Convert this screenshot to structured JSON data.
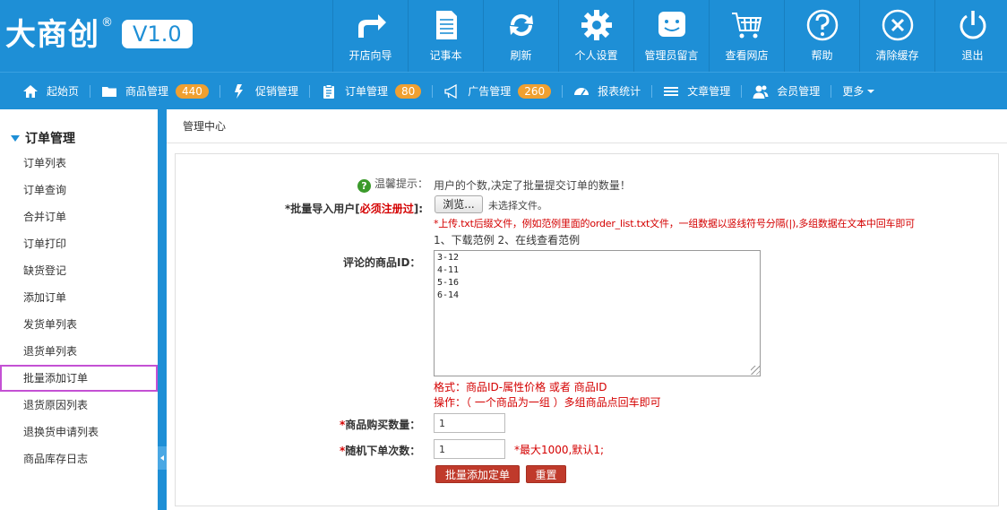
{
  "brand": {
    "logo_text": "大商创",
    "reg": "®",
    "version": "V1.0"
  },
  "top_nav": [
    {
      "label": "开店向导",
      "icon": "share-arrow-icon"
    },
    {
      "label": "记事本",
      "icon": "notepad-icon"
    },
    {
      "label": "刷新",
      "icon": "refresh-icon"
    },
    {
      "label": "个人设置",
      "icon": "gear-icon"
    },
    {
      "label": "管理员留言",
      "icon": "chat-smile-icon"
    },
    {
      "label": "查看网店",
      "icon": "cart-icon"
    },
    {
      "label": "帮助",
      "icon": "help-icon"
    },
    {
      "label": "清除缓存",
      "icon": "close-circle-icon"
    },
    {
      "label": "退出",
      "icon": "power-icon"
    }
  ],
  "sub_nav": [
    {
      "label": "起始页",
      "icon": "home-icon",
      "badge": ""
    },
    {
      "label": "商品管理",
      "icon": "folder-icon",
      "badge": "440"
    },
    {
      "label": "促销管理",
      "icon": "lightning-icon",
      "badge": ""
    },
    {
      "label": "订单管理",
      "icon": "clipboard-icon",
      "badge": "80"
    },
    {
      "label": "广告管理",
      "icon": "megaphone-icon",
      "badge": "260"
    },
    {
      "label": "报表统计",
      "icon": "dashboard-icon",
      "badge": ""
    },
    {
      "label": "文章管理",
      "icon": "list-icon",
      "badge": ""
    },
    {
      "label": "会员管理",
      "icon": "users-icon",
      "badge": ""
    },
    {
      "label": "更多",
      "icon": "",
      "badge": ""
    }
  ],
  "sidebar": {
    "title": "订单管理",
    "items": [
      "订单列表",
      "订单查询",
      "合并订单",
      "订单打印",
      "缺货登记",
      "添加订单",
      "发货单列表",
      "退货单列表",
      "批量添加订单",
      "退货原因列表",
      "退换货申请列表",
      "商品库存日志"
    ],
    "active_index": 8
  },
  "breadcrumb": "管理中心",
  "form": {
    "tip_label": "温馨提示：",
    "tip_text": "用户的个数,决定了批量提交订单的数量！",
    "import_label_prefix": "*批量导入用户[",
    "import_label_link": "必须注册过",
    "import_label_suffix": "]:",
    "browse_button": "浏览...",
    "no_file": "未选择文件。",
    "upload_hint": "*上传.txt后缀文件，例如范例里面的order_list.txt文件，一组数据以竖线符号分隔(|),多组数据在文本中回车即可",
    "sample_links": "1、下载范例  2、在线查看范例",
    "ids_label": "评论的商品ID：",
    "ids_value": "3-12\n4-11\n5-16\n6-14",
    "format_hint": "格式：商品ID-属性价格 或者 商品ID",
    "op_hint": "操作：（ 一个商品为一组 ）多组商品点回车即可",
    "qty_label_star": "*",
    "qty_label": "商品购买数量：",
    "qty_value": "1",
    "times_label_star": "*",
    "times_label": "随机下单次数：",
    "times_value": "1",
    "times_hint": "*最大1000,默认1;",
    "submit_button": "批量添加定单",
    "reset_button": "重置"
  },
  "colors": {
    "primary": "#1e8fd6",
    "badge": "#f0a030",
    "danger": "#c03a2b",
    "highlight": "#c451d4"
  }
}
